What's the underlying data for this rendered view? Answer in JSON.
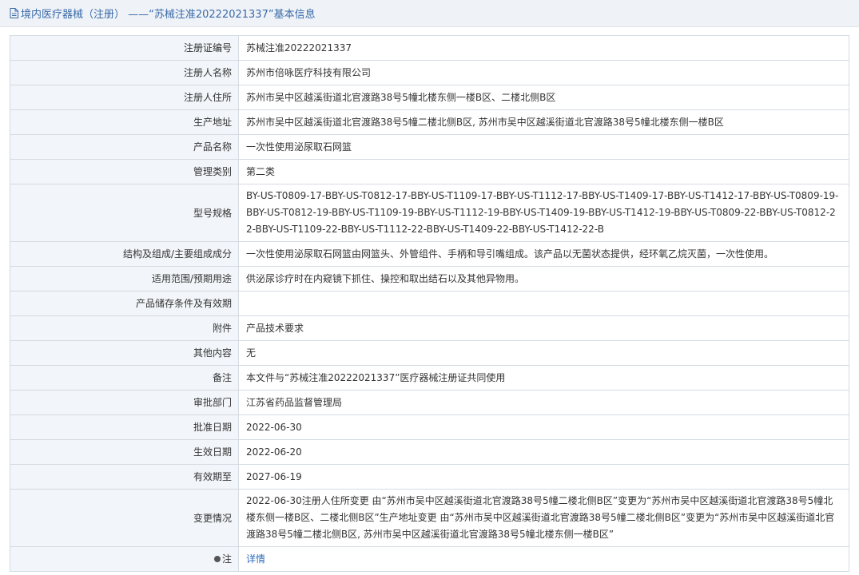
{
  "header": {
    "title": "境内医疗器械（注册） ——“苏械注准20222021337”基本信息",
    "icon": "document-icon",
    "accent_color": "#3a6aa8"
  },
  "rows": [
    {
      "key": "reg-number",
      "label": "注册证编号",
      "value": "苏械注准20222021337"
    },
    {
      "key": "registrant-name",
      "label": "注册人名称",
      "value": "苏州市倍咏医疗科技有限公司"
    },
    {
      "key": "registrant-address",
      "label": "注册人住所",
      "value": "苏州市吴中区越溪街道北官渡路38号5幢北楼东侧一楼B区、二楼北侧B区"
    },
    {
      "key": "production-address",
      "label": "生产地址",
      "value": "苏州市吴中区越溪街道北官渡路38号5幢二楼北侧B区, 苏州市吴中区越溪街道北官渡路38号5幢北楼东侧一楼B区"
    },
    {
      "key": "product-name",
      "label": "产品名称",
      "value": "一次性使用泌尿取石网篮"
    },
    {
      "key": "management-class",
      "label": "管理类别",
      "value": "第二类"
    },
    {
      "key": "model-spec",
      "label": "型号规格",
      "value": "BY-US-T0809-17-BBY-US-T0812-17-BBY-US-T1109-17-BBY-US-T1112-17-BBY-US-T1409-17-BBY-US-T1412-17-BBY-US-T0809-19-BBY-US-T0812-19-BBY-US-T1109-19-BBY-US-T1112-19-BBY-US-T1409-19-BBY-US-T1412-19-BBY-US-T0809-22-BBY-US-T0812-22-BBY-US-T1109-22-BBY-US-T1112-22-BBY-US-T1409-22-BBY-US-T1412-22-B"
    },
    {
      "key": "structure",
      "label": "结构及组成/主要组成成分",
      "value": "一次性使用泌尿取石网篮由网篮头、外管组件、手柄和导引嘴组成。该产品以无菌状态提供，经环氧乙烷灭菌，一次性使用。"
    },
    {
      "key": "intended-use",
      "label": "适用范围/预期用途",
      "value": "供泌尿诊疗时在内窥镜下抓住、操控和取出结石以及其他异物用。"
    },
    {
      "key": "storage",
      "label": "产品储存条件及有效期",
      "value": ""
    },
    {
      "key": "attachment",
      "label": "附件",
      "value": "产品技术要求"
    },
    {
      "key": "other",
      "label": "其他内容",
      "value": "无"
    },
    {
      "key": "remarks",
      "label": "备注",
      "value": "本文件与“苏械注准20222021337”医疗器械注册证共同使用"
    },
    {
      "key": "approval-dept",
      "label": "审批部门",
      "value": "江苏省药品监督管理局"
    },
    {
      "key": "approval-date",
      "label": "批准日期",
      "value": "2022-06-30"
    },
    {
      "key": "effective-date",
      "label": "生效日期",
      "value": "2022-06-20"
    },
    {
      "key": "valid-until",
      "label": "有效期至",
      "value": "2027-06-19"
    },
    {
      "key": "changes",
      "label": "变更情况",
      "value": "2022-06-30注册人住所变更 由“苏州市吴中区越溪街道北官渡路38号5幢二楼北侧B区”变更为“苏州市吴中区越溪街道北官渡路38号5幢北楼东侧一楼B区、二楼北侧B区”生产地址变更 由“苏州市吴中区越溪街道北官渡路38号5幢二楼北侧B区”变更为“苏州市吴中区越溪街道北官渡路38号5幢二楼北侧B区, 苏州市吴中区越溪街道北官渡路38号5幢北楼东侧一楼B区”"
    }
  ],
  "note": {
    "label": "注",
    "icon": "bullet-icon",
    "link_text": "详情",
    "link_color": "#2b6cb7"
  }
}
